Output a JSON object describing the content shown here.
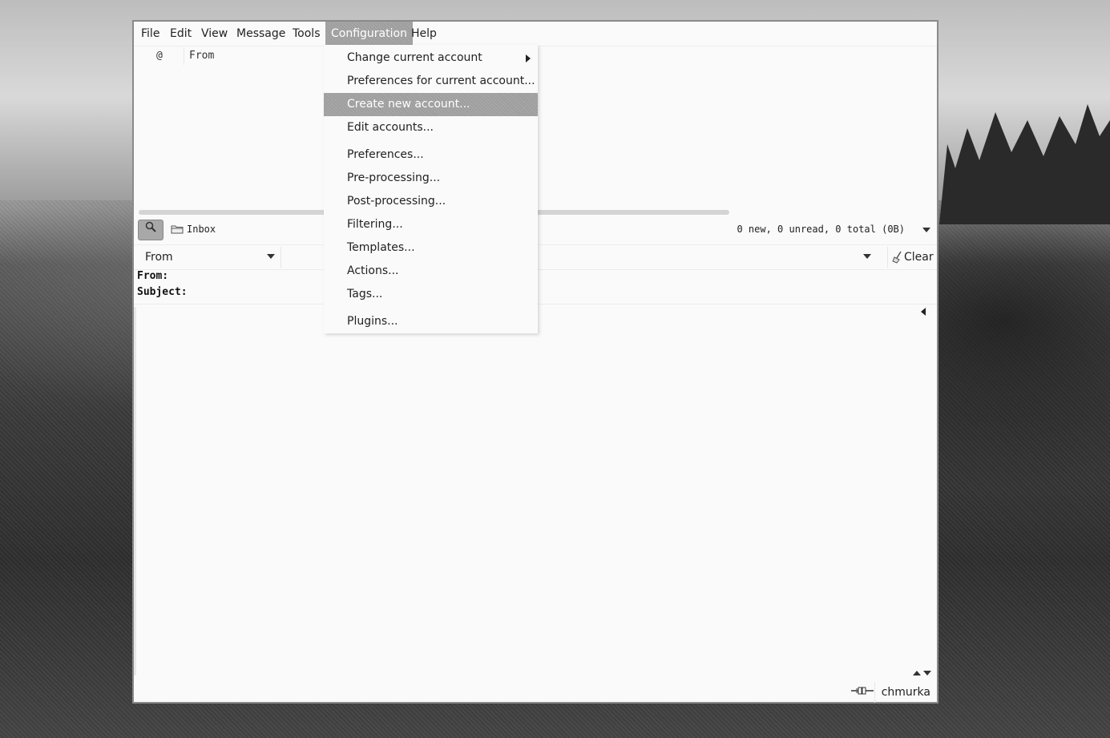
{
  "menubar": {
    "items": [
      {
        "label": "File"
      },
      {
        "label": "Edit"
      },
      {
        "label": "View"
      },
      {
        "label": "Message"
      },
      {
        "label": "Tools"
      },
      {
        "label": "Configuration"
      },
      {
        "label": "Help"
      }
    ]
  },
  "message_list": {
    "columns": [
      {
        "label": "@"
      },
      {
        "label": "From"
      }
    ]
  },
  "folder": {
    "name": "Inbox",
    "stats": "0 new, 0 unread, 0 total (0B)",
    "icon": "folder-icon"
  },
  "search": {
    "type_value": "From",
    "clear_label": "Clear"
  },
  "message_view": {
    "from_label": "From:",
    "subject_label": "Subject:"
  },
  "status": {
    "user": "chmurka",
    "connection_icon": "plug-icon"
  },
  "config_menu": {
    "items": [
      {
        "label": "Change current account",
        "submenu": true
      },
      {
        "label": "Preferences for current account..."
      },
      {
        "label": "Create new account...",
        "highlighted": true
      },
      {
        "label": "Edit accounts..."
      },
      {
        "label": "Preferences..."
      },
      {
        "label": "Pre-processing..."
      },
      {
        "label": "Post-processing..."
      },
      {
        "label": "Filtering..."
      },
      {
        "label": "Templates..."
      },
      {
        "label": "Actions..."
      },
      {
        "label": "Tags..."
      },
      {
        "label": "Plugins..."
      }
    ]
  },
  "colors": {
    "highlight": "#9e9e9e",
    "window_bg": "#fafafa"
  }
}
